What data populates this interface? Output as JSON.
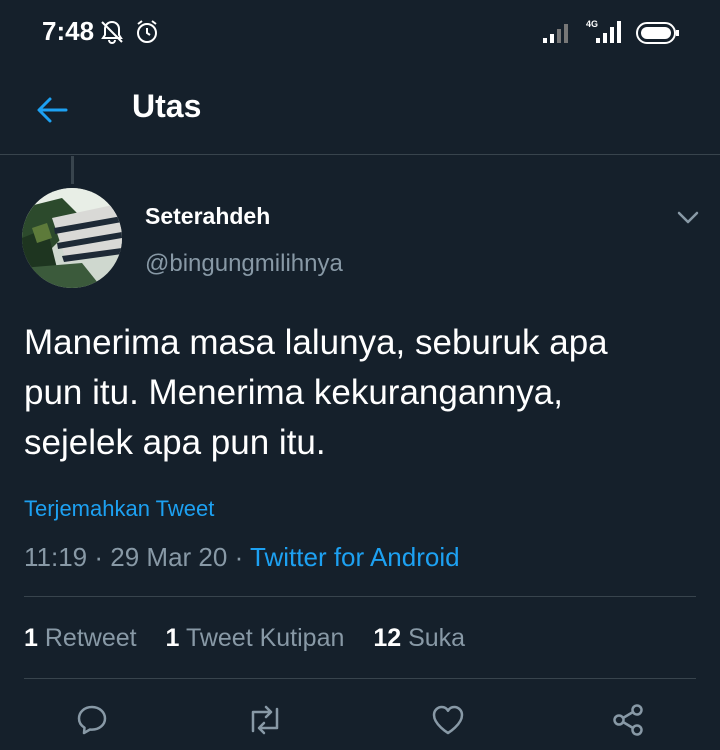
{
  "status_bar": {
    "time": "7:48"
  },
  "header": {
    "title": "Utas"
  },
  "tweet": {
    "display_name": "Seterahdeh",
    "handle": "@bingungmilihnya",
    "text_lines": [
      "Manerima masa lalunya, seburuk apa",
      "pun itu. Menerima kekurangannya,",
      "sejelek apa pun itu."
    ],
    "translate_label": "Terjemahkan Tweet",
    "time": "11:19",
    "date": "29 Mar 20",
    "separator": "·",
    "source": "Twitter for Android"
  },
  "stats": {
    "retweets_count": "1",
    "retweets_label": "Retweet",
    "quotes_count": "1",
    "quotes_label": "Tweet Kutipan",
    "likes_count": "12",
    "likes_label": "Suka"
  },
  "colors": {
    "background": "#15202b",
    "accent": "#1da1f2",
    "secondary_text": "#8899a6",
    "border": "#38444d"
  }
}
